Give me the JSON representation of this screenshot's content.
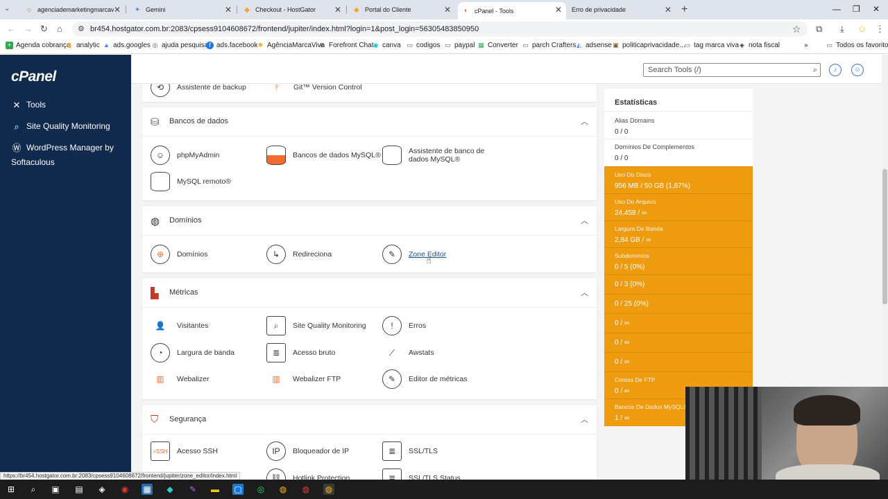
{
  "browser": {
    "tabs": [
      {
        "title": "agenciademarketingmarcaviva"
      },
      {
        "title": "Gemini"
      },
      {
        "title": "Checkout - HostGator"
      },
      {
        "title": "Portal do Cliente"
      },
      {
        "title": "cPanel - Tools"
      },
      {
        "title": "Erro de privacidade"
      }
    ],
    "url": "br454.hostgator.com.br:2083/cpsess9104608672/frontend/jupiter/index.html?login=1&post_login=56305483850950",
    "bookmarks": [
      {
        "label": "Agenda cobrança"
      },
      {
        "label": "analytic"
      },
      {
        "label": "ads.googles"
      },
      {
        "label": "ajuda pesquisa"
      },
      {
        "label": "ads.facebook"
      },
      {
        "label": "AgênciaMarcaViva"
      },
      {
        "label": "Forefront Chat"
      },
      {
        "label": "canva"
      },
      {
        "label": "codigos"
      },
      {
        "label": "paypal"
      },
      {
        "label": "Converter"
      },
      {
        "label": "parch Crafters"
      },
      {
        "label": "adsense"
      },
      {
        "label": "politicaprivacidade..."
      },
      {
        "label": "tag marca viva"
      },
      {
        "label": "nota fiscal"
      }
    ],
    "bookmarks_more": "»",
    "all_bookmarks": "Todos os favoritos",
    "status_link": "https://br454.hostgator.com.br:2083/cpsess9104608672/frontend/jupiter/zone_editor/index.html"
  },
  "cpanel": {
    "logo": "cPanel",
    "sidebar": [
      {
        "label": "Tools"
      },
      {
        "label": "Site Quality Monitoring"
      },
      {
        "label": "WordPress Manager by"
      },
      {
        "label": "Softaculous"
      }
    ],
    "search_placeholder": "Search Tools (/)",
    "partial_row": [
      "Assistente de backup",
      "Git™ Version Control"
    ],
    "sections": [
      {
        "title": "Bancos de dados",
        "items": [
          "phpMyAdmin",
          "Bancos de dados MySQL®",
          "Assistente de banco de",
          "dados MySQL®",
          "MySQL remoto®"
        ]
      },
      {
        "title": "Domínios",
        "items": [
          "Domínios",
          "Redireciona",
          "Zone Editor"
        ]
      },
      {
        "title": "Métricas",
        "items": [
          "Visitantes",
          "Site Quality Monitoring",
          "Erros",
          "Largura de banda",
          "Acesso bruto",
          "Awstats",
          "Webalizer",
          "Webalizer FTP",
          "Editor de métricas"
        ]
      },
      {
        "title": "Segurança",
        "items": [
          "Acesso SSH",
          "Bloqueador de IP",
          "SSL/TLS",
          "Hotlink Protection",
          "SSL/TLS Status"
        ]
      }
    ],
    "stats": {
      "title": "Estatísticas",
      "rows": [
        {
          "label": "Alias Domains",
          "value": "0 / 0"
        },
        {
          "label": "Domínios De Complementos",
          "value": "0 / 0"
        },
        {
          "label": "Uso Do Disco",
          "value": "956 MB / 50 GB   (1,87%)"
        },
        {
          "label": "Uso Do Arquivo",
          "value": "24.458 / ∞"
        },
        {
          "label": "Largura De Banda",
          "value": "2,84 GB / ∞"
        },
        {
          "label": "Subdomínios",
          "value": "0 / 5   (0%)"
        },
        {
          "label": "",
          "value": "0 / 3   (0%)"
        },
        {
          "label": "",
          "value": "0 / 25   (0%)"
        },
        {
          "label": "",
          "value": "0 / ∞"
        },
        {
          "label": "",
          "value": "0 / ∞"
        },
        {
          "label": "",
          "value": "0 / ∞"
        },
        {
          "label": "Contas De FTP",
          "value": "0 / ∞"
        },
        {
          "label": "Bancos De Dados MySQL®",
          "value": "1 / ∞"
        }
      ]
    }
  },
  "colors": {
    "sidebar": "#0f2a4d",
    "stats_orange": "#ef9b0f",
    "icon_accent": "#f26b2f"
  }
}
